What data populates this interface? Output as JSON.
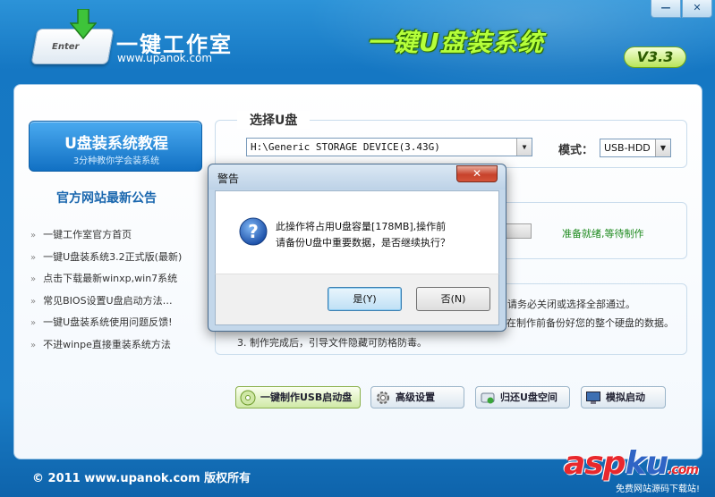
{
  "window": {
    "minimize_label": "—",
    "close_label": "✕"
  },
  "header": {
    "logo_key_text": "Enter",
    "logo_name": "一键工作室",
    "logo_url": "www.upanok.com",
    "product_title": "一键U盘装系统",
    "version": "V3.3"
  },
  "sidebar": {
    "tutorial_title": "U盘装系统教程",
    "tutorial_subtitle": "3分种教你学会装系统",
    "news_heading": "官方网站最新公告",
    "news_items": [
      "一键工作室官方首页",
      "一键U盘装系统3.2正式版(最新)",
      "点击下载最新winxp,win7系统",
      "常见BIOS设置U盘启动方法…",
      "一键U盘装系统使用问题反馈!",
      "不进winpe直接重装系统方法"
    ]
  },
  "usb_panel": {
    "legend": "选择U盘",
    "selected_disk": "H:\\Generic STORAGE DEVICE(3.43G)",
    "mode_label": "模式：",
    "mode_value": "USB-HDD"
  },
  "progress": {
    "status": "准备就绪,等待制作"
  },
  "tips": {
    "line1_tail": "请务必关闭或选择全部通过。",
    "line2_tail": "在制作前备份好您的整个硬盘的数据。",
    "line3": "3. 制作完成后，引导文件隐藏可防格防毒。"
  },
  "actions": [
    {
      "label": "一键制作USB启动盘"
    },
    {
      "label": "高级设置"
    },
    {
      "label": "归还U盘空间"
    },
    {
      "label": "模拟启动"
    }
  ],
  "footer": {
    "copyright": "© 2011 www.upanok.com   版权所有",
    "watermark_a": "asp",
    "watermark_b": "ku",
    "watermark_c": ".com",
    "watermark_sub": "免费网站源码下载站!"
  },
  "dialog": {
    "title": "警告",
    "close_label": "✕",
    "message_line1": "此操作将占用U盘容量[178MB],操作前",
    "message_line2": "请备份U盘中重要数据，是否继续执行？",
    "yes_label": "是(Y)",
    "no_label": "否(N)"
  },
  "colors": {
    "accent_blue": "#1a78c2",
    "title_green": "#b5ff3a",
    "status_green": "#1e8a1e",
    "watermark_red": "#e8282d"
  }
}
